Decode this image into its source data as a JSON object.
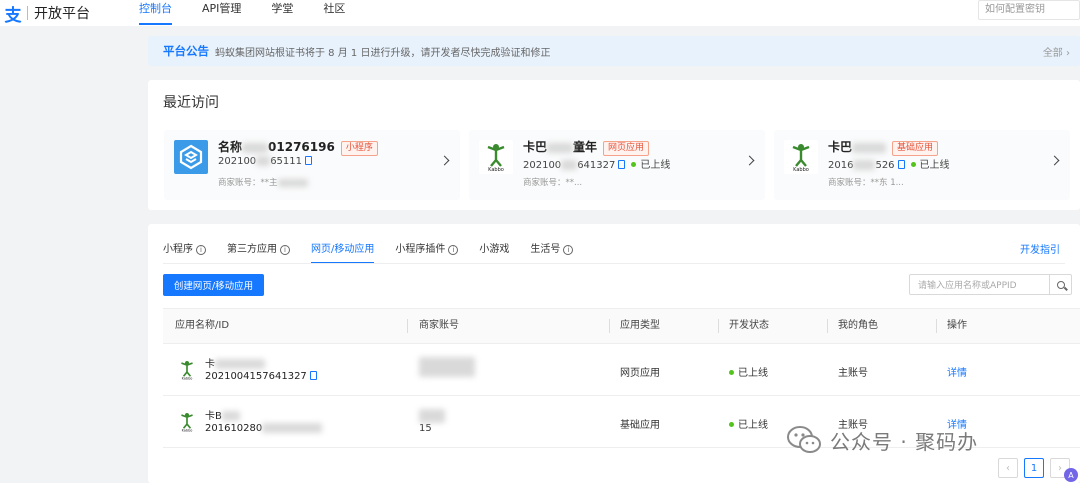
{
  "topbar": {
    "logo_glyph": "支",
    "logo_text": "开放平台",
    "nav": [
      "控制台",
      "API管理",
      "学堂",
      "社区"
    ],
    "search_placeholder": "如何配置密钥"
  },
  "notice": {
    "title": "平台公告",
    "text": "蚂蚁集团网站根证书将于 8 月 1 日进行升级，请开发者尽快完成验证和修正",
    "all_label": "全部 ›"
  },
  "recent": {
    "title": "最近访问",
    "items": [
      {
        "name_prefix": "名称",
        "name_suffix": "01276196",
        "tag": "小程序",
        "id_prefix": "202100",
        "id_suffix": "65111",
        "status": "",
        "merchant": "商家账号：**主",
        "icon": "blue-cube-icon"
      },
      {
        "name_prefix": "卡巴",
        "name_suffix": "童年",
        "tag": "网页应用",
        "id_prefix": "202100",
        "id_suffix": "641327",
        "status": "已上线",
        "merchant": "商家账号：**...",
        "icon": "kabbo-logo-icon"
      },
      {
        "name_prefix": "卡巴",
        "name_suffix": "",
        "tag": "基础应用",
        "id_prefix": "2016",
        "id_suffix": "526",
        "status": "已上线",
        "merchant": "商家账号：**东 1...",
        "icon": "kabbo-logo-icon"
      }
    ]
  },
  "apps": {
    "tabs": [
      {
        "label": "小程序",
        "info": true
      },
      {
        "label": "第三方应用",
        "info": true
      },
      {
        "label": "网页/移动应用",
        "info": false
      },
      {
        "label": "小程序插件",
        "info": true
      },
      {
        "label": "小游戏",
        "info": false
      },
      {
        "label": "生活号",
        "info": true
      }
    ],
    "dev_guide": "开发指引",
    "create_button": "创建网页/移动应用",
    "search_placeholder": "请输入应用名称或APPID",
    "columns": [
      "应用名称/ID",
      "商家账号",
      "应用类型",
      "开发状态",
      "我的角色",
      "操作"
    ],
    "rows": [
      {
        "name": "卡",
        "id": "2021004157641327",
        "type": "网页应用",
        "status": "已上线",
        "role": "主账号",
        "action": "详情"
      },
      {
        "name": "卡B",
        "id": "201610280",
        "merchant": "15",
        "type": "基础应用",
        "status": "已上线",
        "role": "主账号",
        "action": "详情"
      }
    ]
  },
  "watermark": {
    "text": "公众号 · 聚码办"
  },
  "pager": {
    "current": "1",
    "prev": "‹",
    "next": "›"
  },
  "avatar_letter": "A"
}
